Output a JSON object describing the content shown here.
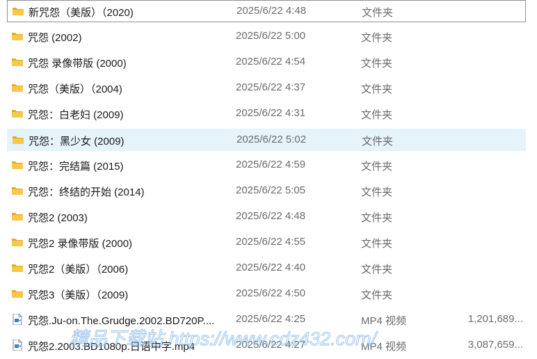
{
  "files": [
    {
      "name": "新咒怨（美版）（2020)",
      "date": "2025/6/22 4:48",
      "type": "文件夹",
      "size": "",
      "icon": "folder-icon"
    },
    {
      "name": "咒怨 (2002)",
      "date": "2025/6/22 5:00",
      "type": "文件夹",
      "size": "",
      "icon": "folder-icon"
    },
    {
      "name": "咒怨 录像带版 (2000)",
      "date": "2025/6/22 4:54",
      "type": "文件夹",
      "size": "",
      "icon": "folder-icon"
    },
    {
      "name": "咒怨（美版）（2004)",
      "date": "2025/6/22 4:37",
      "type": "文件夹",
      "size": "",
      "icon": "folder-icon"
    },
    {
      "name": "咒怨：白老妇 (2009)",
      "date": "2025/6/22 4:31",
      "type": "文件夹",
      "size": "",
      "icon": "folder-icon"
    },
    {
      "name": "咒怨：黑少女 (2009)",
      "date": "2025/6/22 5:02",
      "type": "文件夹",
      "size": "",
      "icon": "folder-icon"
    },
    {
      "name": "咒怨：完结篇 (2015)",
      "date": "2025/6/22 4:59",
      "type": "文件夹",
      "size": "",
      "icon": "folder-icon"
    },
    {
      "name": "咒怨：终结的开始 (2014)",
      "date": "2025/6/22 5:05",
      "type": "文件夹",
      "size": "",
      "icon": "folder-icon"
    },
    {
      "name": "咒怨2 (2003)",
      "date": "2025/6/22 4:48",
      "type": "文件夹",
      "size": "",
      "icon": "folder-icon"
    },
    {
      "name": "咒怨2 录像带版 (2000)",
      "date": "2025/6/22 4:55",
      "type": "文件夹",
      "size": "",
      "icon": "folder-icon"
    },
    {
      "name": "咒怨2（美版）（2006)",
      "date": "2025/6/22 4:40",
      "type": "文件夹",
      "size": "",
      "icon": "folder-icon"
    },
    {
      "name": "咒怨3（美版）（2009)",
      "date": "2025/6/22 4:50",
      "type": "文件夹",
      "size": "",
      "icon": "folder-icon"
    },
    {
      "name": "咒怨.Ju-on.The.Grudge.2002.BD720P....",
      "date": "2025/6/22 4:25",
      "type": "MP4 视频",
      "size": "1,201,689...",
      "icon": "video-file-icon"
    },
    {
      "name": "咒怨2.2003.BD1080p.日语中字.mp4",
      "date": "2025/6/22 4:27",
      "type": "MP4 视频",
      "size": "3,087,659...",
      "icon": "video-file-icon"
    }
  ],
  "watermark": {
    "text": "精品下载站 https://www.cdz432.com/"
  },
  "colors": {
    "folder": "#f8c84a",
    "folder_dark": "#e8a820",
    "hover": "#e5f3fb",
    "secondary_text": "#6b6b6b",
    "watermark": "#5aa0e0"
  }
}
